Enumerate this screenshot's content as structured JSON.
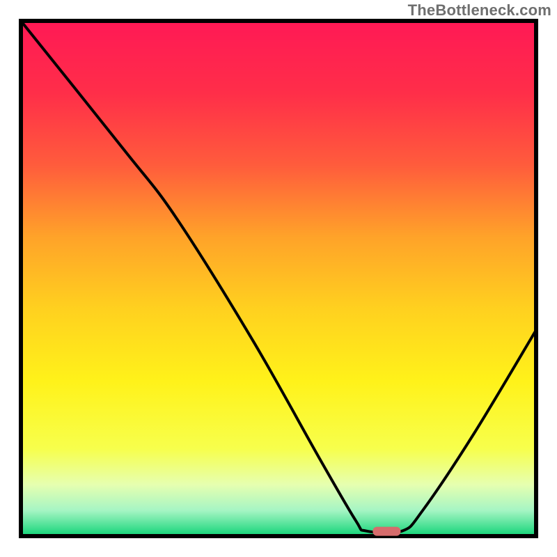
{
  "watermark": "TheBottleneck.com",
  "chart_data": {
    "type": "line",
    "title": "",
    "xlabel": "",
    "ylabel": "",
    "xlim": [
      0,
      100
    ],
    "ylim": [
      0,
      100
    ],
    "grid": false,
    "legend": false,
    "background_gradient_stops": [
      {
        "offset": 0,
        "color": "#ff1955"
      },
      {
        "offset": 14,
        "color": "#ff2e49"
      },
      {
        "offset": 28,
        "color": "#ff5c3c"
      },
      {
        "offset": 42,
        "color": "#ffa329"
      },
      {
        "offset": 56,
        "color": "#ffd11f"
      },
      {
        "offset": 70,
        "color": "#fff21a"
      },
      {
        "offset": 83,
        "color": "#f7ff4c"
      },
      {
        "offset": 90,
        "color": "#e6ffb0"
      },
      {
        "offset": 95,
        "color": "#a6f5c4"
      },
      {
        "offset": 100,
        "color": "#11d477"
      }
    ],
    "marker": {
      "x": 71,
      "y": 1,
      "color": "#d66c6c"
    },
    "series": [
      {
        "name": "curve",
        "color": "#000000",
        "points": [
          {
            "x": 0,
            "y": 100
          },
          {
            "x": 20,
            "y": 75
          },
          {
            "x": 30,
            "y": 62
          },
          {
            "x": 45,
            "y": 38
          },
          {
            "x": 58,
            "y": 15
          },
          {
            "x": 65,
            "y": 3
          },
          {
            "x": 67,
            "y": 1
          },
          {
            "x": 74,
            "y": 1
          },
          {
            "x": 78,
            "y": 5
          },
          {
            "x": 88,
            "y": 20
          },
          {
            "x": 100,
            "y": 40
          }
        ]
      }
    ]
  }
}
